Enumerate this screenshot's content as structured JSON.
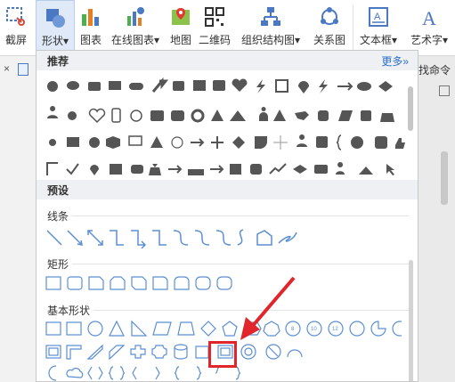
{
  "ribbon": {
    "buttons": [
      {
        "id": "screenshot",
        "label": "截屏"
      },
      {
        "id": "shape",
        "label": "形状"
      },
      {
        "id": "chart",
        "label": "图表"
      },
      {
        "id": "online_chart",
        "label": "在线图表"
      },
      {
        "id": "map",
        "label": "地图"
      },
      {
        "id": "qrcode",
        "label": "二维码"
      },
      {
        "id": "org_chart",
        "label": "组织结构图"
      },
      {
        "id": "relation",
        "label": "关系图"
      },
      {
        "id": "textbox",
        "label": "文本框"
      },
      {
        "id": "wordart",
        "label": "艺术字"
      }
    ]
  },
  "doc": {
    "close_label": "×",
    "right_cmd": "找命令"
  },
  "panel": {
    "recommend_title": "推荐",
    "more_label": "更多»",
    "preset_title": "预设",
    "lines_label": "线条",
    "rect_label": "矩形",
    "basic_label": "基本形状"
  },
  "colors": {
    "accent": "#2f6fce",
    "highlight": "#e0262b",
    "shape_dark": "#555555",
    "shape_blue": "#5b8fd0"
  }
}
